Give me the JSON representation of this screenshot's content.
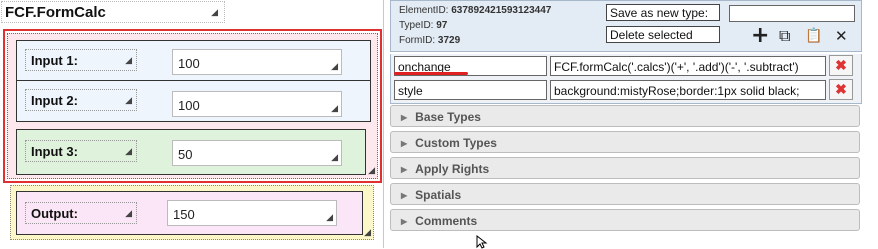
{
  "form": {
    "title": "FCF.FormCalc",
    "inputs": [
      {
        "label": "Input 1:",
        "value": "100"
      },
      {
        "label": "Input 2:",
        "value": "100"
      },
      {
        "label": "Input 3:",
        "value": "50"
      }
    ],
    "output": {
      "label": "Output:",
      "value": "150"
    },
    "resize_glyph": "◢",
    "colors": {
      "calc_border": "#e03030",
      "calc_bg": "#fde8ee",
      "input12_bg": "#eef5fd",
      "input3_bg": "#dff2dc",
      "output_bg": "#fbf7c8",
      "output_field_bg": "#fbe6f7"
    }
  },
  "info": {
    "element_id_label": "ElementID:",
    "element_id": "637892421593123447",
    "type_id_label": "TypeID:",
    "type_id": "97",
    "form_id_label": "FormID:",
    "form_id": "3729",
    "save_as_type_label": "Save as new type:",
    "save_as_type_value": "",
    "delete_selected_label": "Delete selected",
    "tools": [
      {
        "icon": "add-icon",
        "glyph": "+"
      },
      {
        "icon": "duplicate-icon",
        "glyph": "⧉"
      },
      {
        "icon": "paste-icon",
        "glyph": "📋"
      },
      {
        "icon": "close-icon",
        "glyph": "✕"
      }
    ]
  },
  "properties": [
    {
      "name": "onchange",
      "value": "FCF.formCalc('.calcs')('+', '.add')('-', '.subtract')",
      "delete_glyph": "✖"
    },
    {
      "name": "style",
      "value": "background:mistyRose;border:1px solid black;",
      "delete_glyph": "✖"
    }
  ],
  "sections": [
    {
      "label": "Base Types",
      "arrow": "▶"
    },
    {
      "label": "Custom Types",
      "arrow": "▶"
    },
    {
      "label": "Apply Rights",
      "arrow": "▶"
    },
    {
      "label": "Spatials",
      "arrow": "▶"
    },
    {
      "label": "Comments",
      "arrow": "▶"
    }
  ]
}
